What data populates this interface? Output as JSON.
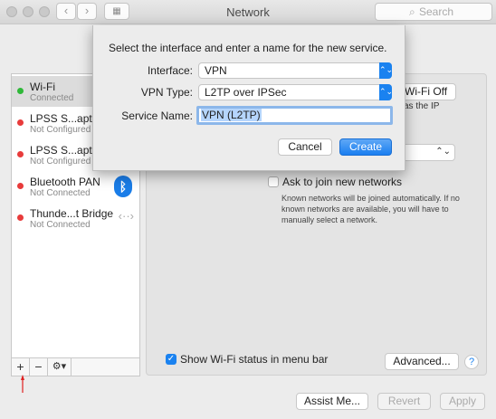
{
  "window": {
    "title": "Network",
    "search_placeholder": "Search"
  },
  "toolbar": {
    "back_icon": "chevron-left-icon",
    "forward_icon": "chevron-right-icon",
    "show_all_icon": "grid-icon"
  },
  "services": [
    {
      "name": "Wi-Fi",
      "status": "Connected",
      "status_color": "#2fb838"
    },
    {
      "name": "LPSS S...apter",
      "status": "Not Configured",
      "status_color": "#e83b3b"
    },
    {
      "name": "LPSS S...apter",
      "status": "Not Configured",
      "status_color": "#e83b3b"
    },
    {
      "name": "Bluetooth PAN",
      "status": "Not Connected",
      "status_color": "#e83b3b",
      "icon": "bluetooth-icon"
    },
    {
      "name": "Thunde...t Bridge",
      "status": "Not Connected",
      "status_color": "#e83b3b",
      "icon": "thunderbolt-bridge-icon"
    }
  ],
  "sidebar_buttons": {
    "add": "+",
    "remove": "−",
    "action": "⚙▾"
  },
  "main": {
    "turn_wifi_off": "Wi-Fi Off",
    "ip_text_fragment": "as the IP",
    "ask_join_label": "Ask to join new networks",
    "ask_join_help": "Known networks will be joined automatically. If no known networks are available, you will have to manually select a network.",
    "show_status_label": "Show Wi-Fi status in menu bar",
    "show_status_checked": true,
    "advanced_label": "Advanced...",
    "help_label": "?"
  },
  "footer": {
    "assist": "Assist Me...",
    "revert": "Revert",
    "apply": "Apply"
  },
  "sheet": {
    "prompt": "Select the interface and enter a name for the new service.",
    "interface_label": "Interface:",
    "interface_value": "VPN",
    "vpn_type_label": "VPN Type:",
    "vpn_type_value": "L2TP over IPSec",
    "service_name_label": "Service Name:",
    "service_name_value": "VPN (L2TP)",
    "cancel_label": "Cancel",
    "create_label": "Create"
  },
  "colors": {
    "accent": "#1a82f0",
    "annotation_arrow": "#e02020"
  }
}
